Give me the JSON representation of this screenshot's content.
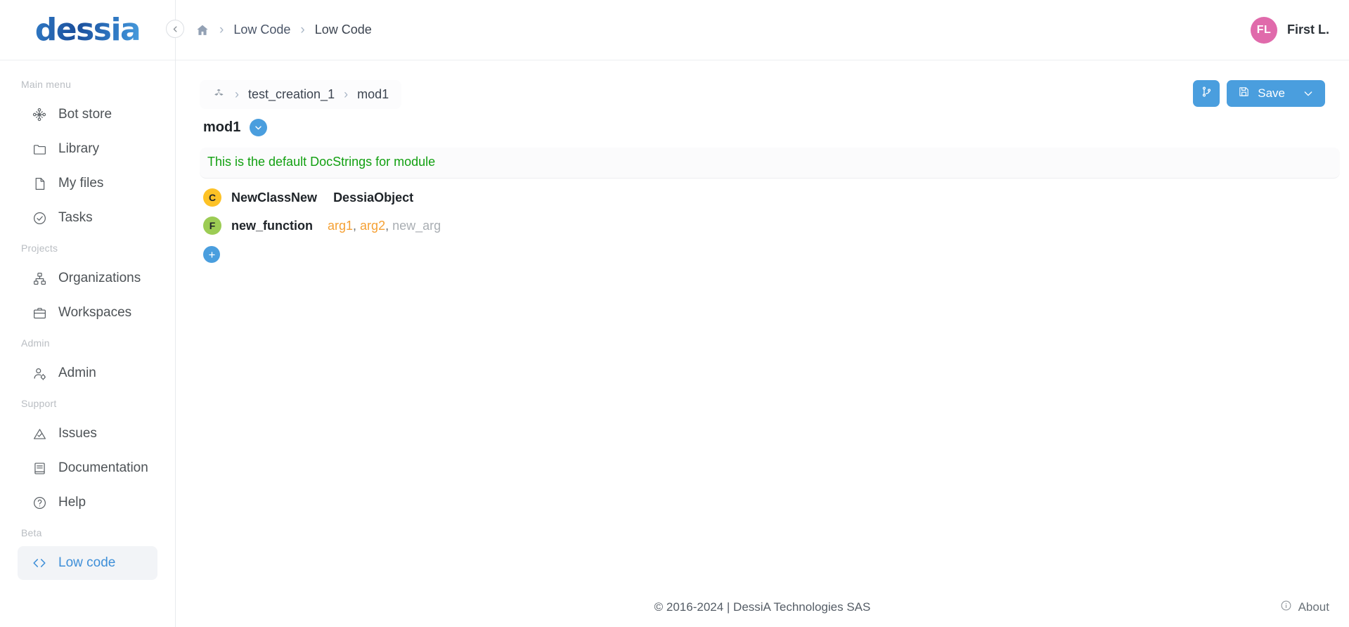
{
  "brand": {
    "logo_text": "dessia",
    "accent": "#4a9ede"
  },
  "sidebar": {
    "collapse_icon": "chevron-left-icon",
    "sections": [
      {
        "label": "Main menu",
        "items": [
          {
            "label": "Bot store",
            "icon": "bot-store-icon"
          },
          {
            "label": "Library",
            "icon": "folder-icon"
          },
          {
            "label": "My files",
            "icon": "file-icon"
          },
          {
            "label": "Tasks",
            "icon": "check-circle-icon"
          }
        ]
      },
      {
        "label": "Projects",
        "items": [
          {
            "label": "Organizations",
            "icon": "org-chart-icon"
          },
          {
            "label": "Workspaces",
            "icon": "briefcase-icon"
          }
        ]
      },
      {
        "label": "Admin",
        "items": [
          {
            "label": "Admin",
            "icon": "user-cog-icon"
          }
        ]
      },
      {
        "label": "Support",
        "items": [
          {
            "label": "Issues",
            "icon": "warning-triangle-icon"
          },
          {
            "label": "Documentation",
            "icon": "book-icon"
          },
          {
            "label": "Help",
            "icon": "question-circle-icon"
          }
        ]
      },
      {
        "label": "Beta",
        "items": [
          {
            "label": "Low code",
            "icon": "code-brackets-icon",
            "active": true
          }
        ]
      }
    ]
  },
  "topbar": {
    "home_icon": "home-icon",
    "breadcrumb": [
      "Low Code",
      "Low Code"
    ],
    "user": {
      "initials": "FL",
      "name": "First L.",
      "avatar_color": "#e06aab"
    }
  },
  "content": {
    "module_breadcrumb": {
      "package_icon": "package-cubes-icon",
      "segments": [
        "test_creation_1",
        "mod1"
      ]
    },
    "actions": {
      "branch_button_icon": "git-branch-icon",
      "save_label": "Save",
      "save_icon": "floppy-disk-icon",
      "save_dropdown_icon": "chevron-down-icon"
    },
    "module": {
      "title": "mod1",
      "expand_icon": "chevron-down-icon",
      "docstring": "This is the default DocStrings for module",
      "docstring_color": "#12a011"
    },
    "members": [
      {
        "kind_badge": "C",
        "badge_color": "#fdc226",
        "name": "NewClassNew",
        "base": "DessiaObject",
        "args": []
      },
      {
        "kind_badge": "F",
        "badge_color": "#9ccc54",
        "name": "new_function",
        "base": "",
        "args": [
          {
            "text": "arg1",
            "muted": false
          },
          {
            "text": "arg2",
            "muted": false
          },
          {
            "text": "new_arg",
            "muted": true
          }
        ]
      }
    ],
    "add_button_icon": "plus-icon"
  },
  "footer": {
    "copyright": "© 2016-2024 | DessiA Technologies SAS",
    "about_label": "About",
    "about_icon": "info-circle-icon"
  }
}
